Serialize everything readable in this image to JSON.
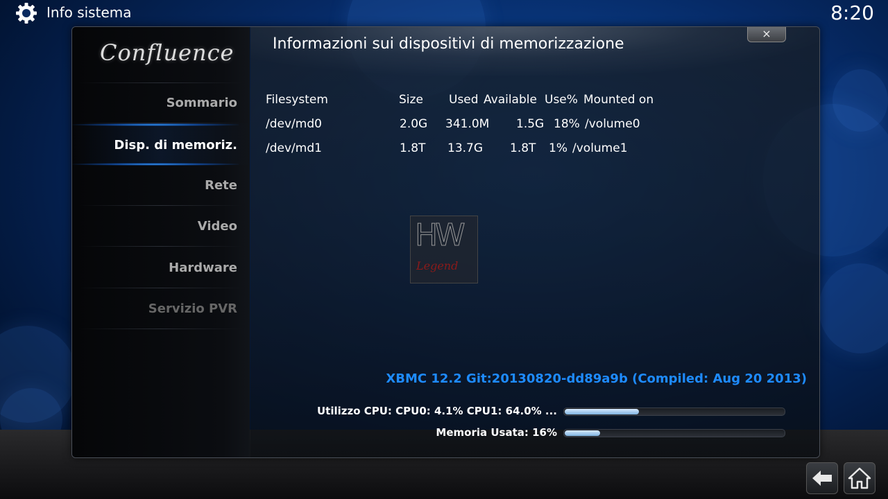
{
  "topbar": {
    "title": "Info sistema",
    "clock": "8:20"
  },
  "sidebar": {
    "logo": "Confluence",
    "items": [
      {
        "label": "Sommario"
      },
      {
        "label": "Disp. di memoriz."
      },
      {
        "label": "Rete"
      },
      {
        "label": "Video"
      },
      {
        "label": "Hardware"
      },
      {
        "label": "Servizio PVR"
      }
    ]
  },
  "content": {
    "title": "Informazioni sui dispositivi di memorizzazione",
    "close_label": "×",
    "table": {
      "headers": [
        "Filesystem",
        "Size",
        "Used",
        "Available",
        "Use%",
        "Mounted on"
      ],
      "rows": [
        [
          "/dev/md0",
          "2.0G",
          "341.0M",
          "1.5G",
          "18%",
          "/volume0"
        ],
        [
          "/dev/md1",
          "1.8T",
          "13.7G",
          "1.8T",
          "1%",
          "/volume1"
        ]
      ]
    },
    "watermark": {
      "top": "HW",
      "bottom": "Legend"
    },
    "version": "XBMC 12.2 Git:20130820-dd89a9b (Compiled: Aug 20 2013)",
    "stats": {
      "cpu_label": "Utilizzo CPU: CPU0: 4.1% CPU1: 64.0% ...",
      "cpu_fill": 0.34,
      "mem_label": "Memoria Usata: 16%",
      "mem_fill": 0.16
    }
  },
  "colors": {
    "accent": "#1e8bff",
    "glow": "#39a0ff"
  },
  "nav": {
    "back_icon": "back-arrow-icon",
    "home_icon": "home-icon"
  }
}
